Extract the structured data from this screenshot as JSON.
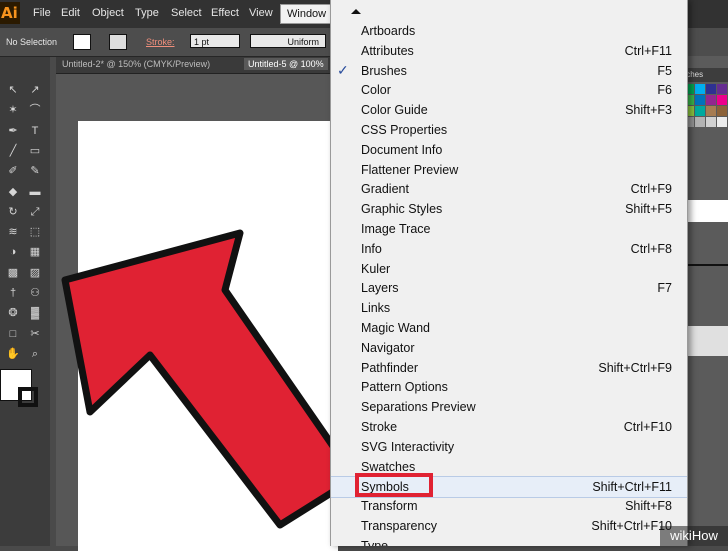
{
  "app": {
    "logo": "Ai"
  },
  "menubar": {
    "items": [
      "File",
      "Edit",
      "Object",
      "Type",
      "Select",
      "Effect",
      "View",
      "Window"
    ],
    "active": "Window"
  },
  "control_bar": {
    "selection": "No Selection",
    "stroke_label": "Stroke:",
    "weight": "1 pt",
    "profile": "Uniform"
  },
  "doc_tabs": [
    "Untitled-2* @ 150% (CMYK/Preview)",
    "Untitled-5 @ 100%"
  ],
  "window_menu": {
    "items": [
      {
        "label": "Artboards",
        "shortcut": ""
      },
      {
        "label": "Attributes",
        "shortcut": "Ctrl+F11"
      },
      {
        "label": "Brushes",
        "shortcut": "F5",
        "checked": true
      },
      {
        "label": "Color",
        "shortcut": "F6"
      },
      {
        "label": "Color Guide",
        "shortcut": "Shift+F3"
      },
      {
        "label": "CSS Properties",
        "shortcut": ""
      },
      {
        "label": "Document Info",
        "shortcut": ""
      },
      {
        "label": "Flattener Preview",
        "shortcut": ""
      },
      {
        "label": "Gradient",
        "shortcut": "Ctrl+F9"
      },
      {
        "label": "Graphic Styles",
        "shortcut": "Shift+F5"
      },
      {
        "label": "Image Trace",
        "shortcut": ""
      },
      {
        "label": "Info",
        "shortcut": "Ctrl+F8"
      },
      {
        "label": "Kuler",
        "shortcut": ""
      },
      {
        "label": "Layers",
        "shortcut": "F7"
      },
      {
        "label": "Links",
        "shortcut": ""
      },
      {
        "label": "Magic Wand",
        "shortcut": ""
      },
      {
        "label": "Navigator",
        "shortcut": ""
      },
      {
        "label": "Pathfinder",
        "shortcut": "Shift+Ctrl+F9"
      },
      {
        "label": "Pattern Options",
        "shortcut": ""
      },
      {
        "label": "Separations Preview",
        "shortcut": ""
      },
      {
        "label": "Stroke",
        "shortcut": "Ctrl+F10"
      },
      {
        "label": "SVG Interactivity",
        "shortcut": ""
      },
      {
        "label": "Swatches",
        "shortcut": ""
      },
      {
        "label": "Symbols",
        "shortcut": "Shift+Ctrl+F11",
        "highlighted": true
      },
      {
        "label": "Transform",
        "shortcut": "Shift+F8"
      },
      {
        "label": "Transparency",
        "shortcut": "Shift+Ctrl+F10"
      },
      {
        "label": "Type",
        "shortcut": ""
      }
    ]
  },
  "right_panel": {
    "tab": "tches"
  },
  "watermark": "wikiHow",
  "colors": {
    "arrow": "#e02233",
    "highlight_box": "#e02233"
  },
  "icons": [
    "select-icon",
    "direct-select-icon",
    "magic-wand-icon",
    "lasso-icon",
    "pen-icon",
    "type-icon",
    "line-icon",
    "rectangle-icon",
    "paintbrush-icon",
    "pencil-icon",
    "blob-brush-icon",
    "eraser-icon",
    "rotate-icon",
    "scale-icon",
    "width-icon",
    "free-transform-icon",
    "shape-builder-icon",
    "perspective-icon",
    "mesh-icon",
    "gradient-icon",
    "eyedropper-icon",
    "blend-icon",
    "symbol-sprayer-icon",
    "graph-icon",
    "artboard-icon",
    "slice-icon",
    "hand-icon",
    "zoom-icon"
  ]
}
